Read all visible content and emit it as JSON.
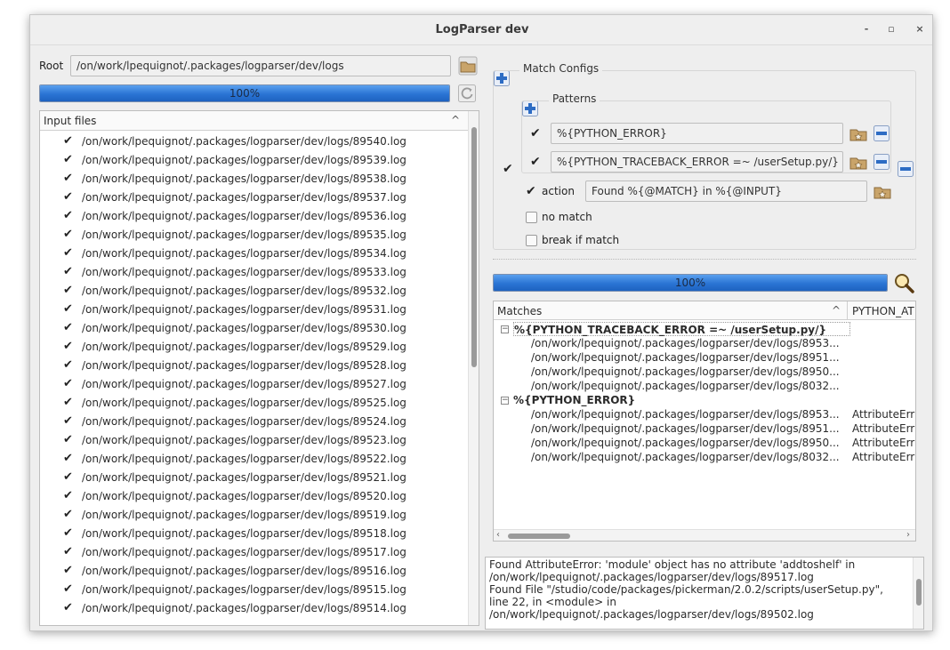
{
  "window": {
    "title": "LogParser dev",
    "minimize": "-",
    "maximize": "▫",
    "close": "×"
  },
  "root": {
    "label": "Root",
    "path": "/on/work/lpequignot/.packages/logparser/dev/logs"
  },
  "progress_left": {
    "value": 1.0,
    "text": "100%"
  },
  "input_files": {
    "header": "Input files",
    "sort_indicator": "^",
    "check": "✔",
    "items": [
      "/on/work/lpequignot/.packages/logparser/dev/logs/89540.log",
      "/on/work/lpequignot/.packages/logparser/dev/logs/89539.log",
      "/on/work/lpequignot/.packages/logparser/dev/logs/89538.log",
      "/on/work/lpequignot/.packages/logparser/dev/logs/89537.log",
      "/on/work/lpequignot/.packages/logparser/dev/logs/89536.log",
      "/on/work/lpequignot/.packages/logparser/dev/logs/89535.log",
      "/on/work/lpequignot/.packages/logparser/dev/logs/89534.log",
      "/on/work/lpequignot/.packages/logparser/dev/logs/89533.log",
      "/on/work/lpequignot/.packages/logparser/dev/logs/89532.log",
      "/on/work/lpequignot/.packages/logparser/dev/logs/89531.log",
      "/on/work/lpequignot/.packages/logparser/dev/logs/89530.log",
      "/on/work/lpequignot/.packages/logparser/dev/logs/89529.log",
      "/on/work/lpequignot/.packages/logparser/dev/logs/89528.log",
      "/on/work/lpequignot/.packages/logparser/dev/logs/89527.log",
      "/on/work/lpequignot/.packages/logparser/dev/logs/89525.log",
      "/on/work/lpequignot/.packages/logparser/dev/logs/89524.log",
      "/on/work/lpequignot/.packages/logparser/dev/logs/89523.log",
      "/on/work/lpequignot/.packages/logparser/dev/logs/89522.log",
      "/on/work/lpequignot/.packages/logparser/dev/logs/89521.log",
      "/on/work/lpequignot/.packages/logparser/dev/logs/89520.log",
      "/on/work/lpequignot/.packages/logparser/dev/logs/89519.log",
      "/on/work/lpequignot/.packages/logparser/dev/logs/89518.log",
      "/on/work/lpequignot/.packages/logparser/dev/logs/89517.log",
      "/on/work/lpequignot/.packages/logparser/dev/logs/89516.log",
      "/on/work/lpequignot/.packages/logparser/dev/logs/89515.log",
      "/on/work/lpequignot/.packages/logparser/dev/logs/89514.log"
    ]
  },
  "match_configs": {
    "title": "Match Configs",
    "patterns_title": "Patterns",
    "check": "✔",
    "patterns": [
      {
        "value": "%{PYTHON_ERROR}"
      },
      {
        "value": "%{PYTHON_TRACEBACK_ERROR =~ /userSetup.py/}"
      }
    ],
    "action_label": "action",
    "action_value": "Found %{@MATCH} in %{@INPUT}",
    "no_match_label": "no match",
    "break_if_match_label": "break if match"
  },
  "progress_right": {
    "value": 1.0,
    "text": "100%"
  },
  "matches": {
    "col_matches": "Matches",
    "col_python": "PYTHON_AT",
    "sort_indicator": "^",
    "collapse": "−",
    "groups": [
      {
        "name": "%{PYTHON_TRACEBACK_ERROR =~ /userSetup.py/}",
        "rows": [
          {
            "path": "/on/work/lpequignot/.packages/logparser/dev/logs/8953...",
            "extra": ""
          },
          {
            "path": "/on/work/lpequignot/.packages/logparser/dev/logs/8951...",
            "extra": ""
          },
          {
            "path": "/on/work/lpequignot/.packages/logparser/dev/logs/8950...",
            "extra": ""
          },
          {
            "path": "/on/work/lpequignot/.packages/logparser/dev/logs/8032...",
            "extra": ""
          }
        ]
      },
      {
        "name": "%{PYTHON_ERROR}",
        "rows": [
          {
            "path": "/on/work/lpequignot/.packages/logparser/dev/logs/8953...",
            "extra": "AttributeErr"
          },
          {
            "path": "/on/work/lpequignot/.packages/logparser/dev/logs/8951...",
            "extra": "AttributeErr"
          },
          {
            "path": "/on/work/lpequignot/.packages/logparser/dev/logs/8950...",
            "extra": "AttributeErr"
          },
          {
            "path": "/on/work/lpequignot/.packages/logparser/dev/logs/8032...",
            "extra": "AttributeErr"
          }
        ]
      }
    ]
  },
  "log_output": {
    "lines": [
      "Found AttributeError: 'module' object has no attribute 'addtoshelf' in",
      "/on/work/lpequignot/.packages/logparser/dev/logs/89517.log",
      "Found   File \"/studio/code/packages/pickerman/2.0.2/scripts/userSetup.py\",",
      "line 22, in <module> in",
      "/on/work/lpequignot/.packages/logparser/dev/logs/89502.log"
    ]
  },
  "colors": {
    "progress": "#2a74d4",
    "window_bg": "#eeeeee"
  }
}
